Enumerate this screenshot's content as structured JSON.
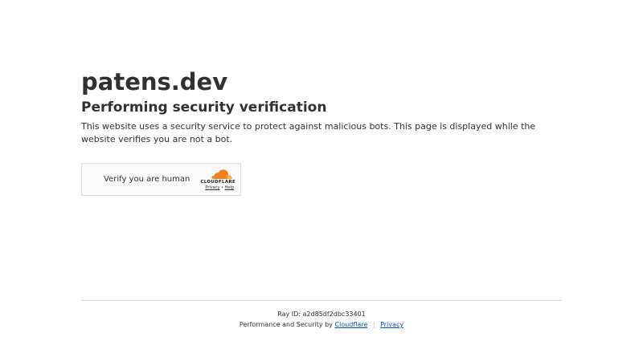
{
  "site": {
    "name": "patens.dev"
  },
  "main": {
    "headline": "Performing security verification",
    "description": "This website uses a security service to protect against malicious bots. This page is displayed while the website verifies you are not a bot."
  },
  "widget": {
    "label": "Verify you are human",
    "brand": "CLOUDFLARE",
    "privacy_link": "Privacy",
    "link_separator": "•",
    "help_link": "Help",
    "brand_color_primary": "#f38020",
    "brand_color_secondary": "#faae40"
  },
  "footer": {
    "ray_id_label": "Ray ID:",
    "ray_id_value": "a2d85df2dbc33401",
    "performance_text": "Performance and Security by",
    "cloudflare_link": "Cloudflare",
    "separator": "|",
    "privacy_link": "Privacy",
    "link_color": "#0051c3"
  }
}
